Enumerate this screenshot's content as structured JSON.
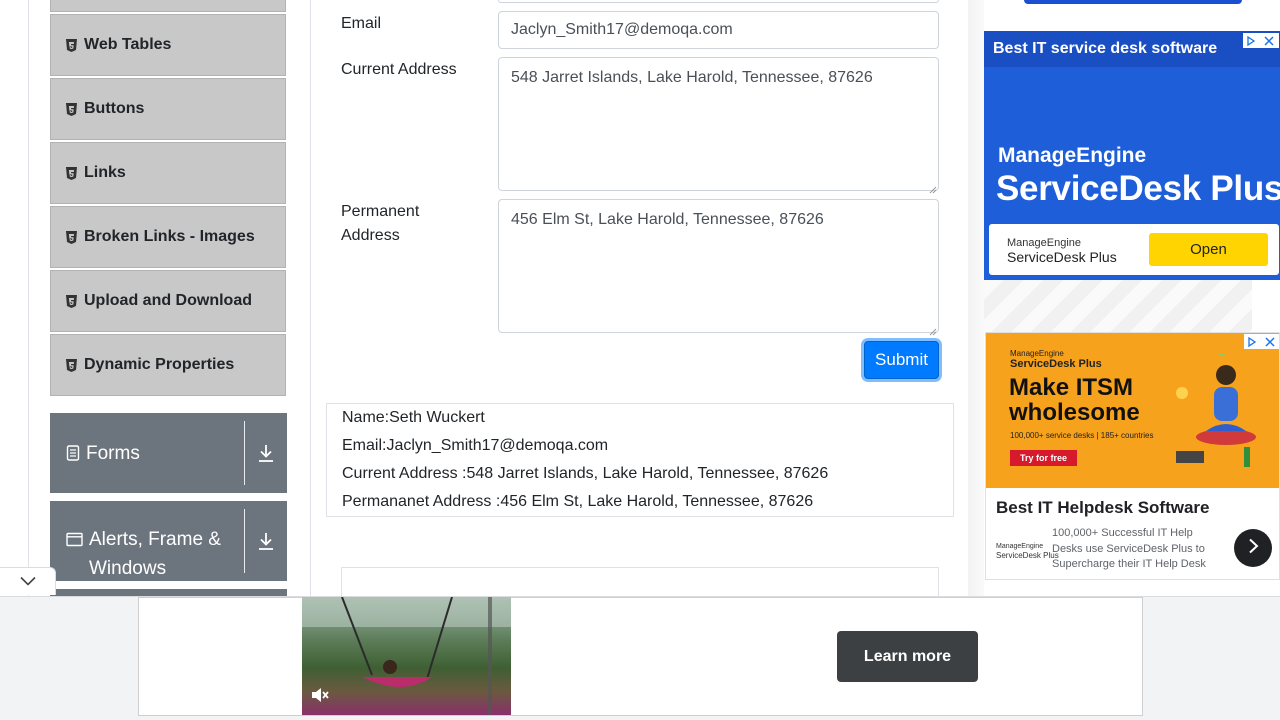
{
  "sidebar": {
    "items": [
      {
        "label": "Web Tables",
        "icon": "html5-icon"
      },
      {
        "label": "Buttons",
        "icon": "html5-icon"
      },
      {
        "label": "Links",
        "icon": "html5-icon"
      },
      {
        "label": "Broken Links - Images",
        "icon": "html5-icon"
      },
      {
        "label": "Upload and Download",
        "icon": "html5-icon"
      },
      {
        "label": "Dynamic Properties",
        "icon": "html5-icon"
      }
    ],
    "groups": [
      {
        "label": "Forms",
        "icon": "form-icon",
        "toggle_icon": "download-arrow-icon"
      },
      {
        "label": "Alerts, Frame & Windows",
        "icon": "window-icon",
        "toggle_icon": "download-arrow-icon"
      }
    ]
  },
  "form": {
    "email": {
      "label": "Email",
      "value": "Jaclyn_Smith17@demoqa.com"
    },
    "current_address": {
      "label": "Current Address",
      "value": "548 Jarret Islands, Lake Harold, Tennessee, 87626"
    },
    "permanent_address": {
      "label_line1": "Permanent",
      "label_line2": "Address",
      "value": "456 Elm St, Lake Harold, Tennessee, 87626"
    },
    "submit_label": "Submit"
  },
  "output": {
    "name": "Name:Seth Wuckert",
    "email": "Email:Jaclyn_Smith17@demoqa.com",
    "current_address": "Current Address :548 Jarret Islands, Lake Harold, Tennessee, 87626",
    "permanent_address": "Permananet Address :456 Elm St, Lake Harold, Tennessee, 87626"
  },
  "ads": {
    "ad1": {
      "headline": "Best IT service desk software",
      "brand_top": "ManageEngine",
      "product": "ServiceDesk Plus",
      "logo_brand": "ManageEngine",
      "logo_product": "ServiceDesk Plus",
      "cta": "Open",
      "colors": {
        "background": "#1e5ed8",
        "cta": "#ffd400"
      }
    },
    "ad2": {
      "brand": "ManageEngine",
      "product": "ServiceDesk Plus",
      "headline_line1": "Make ITSM",
      "headline_line2": "wholesome",
      "stats": "100,000+ service desks | 185+ countries",
      "try_label": "Try for free",
      "title": "Best IT Helpdesk Software",
      "logo_brand": "ManageEngine",
      "logo_product": "ServiceDesk Plus",
      "desc": "100,000+ Successful IT Help Desks use ServiceDesk Plus to Supercharge their IT Help Desk",
      "colors": {
        "background": "#f7a21c"
      }
    },
    "video_ad": {
      "learn_more": "Learn more",
      "mute_icon": "muted-speaker-icon"
    }
  },
  "collapse_icon": "chevron-down-icon",
  "colors": {
    "primary": "#007bff",
    "sidebar_item": "#c8c8c8",
    "group": "#6c757d"
  }
}
